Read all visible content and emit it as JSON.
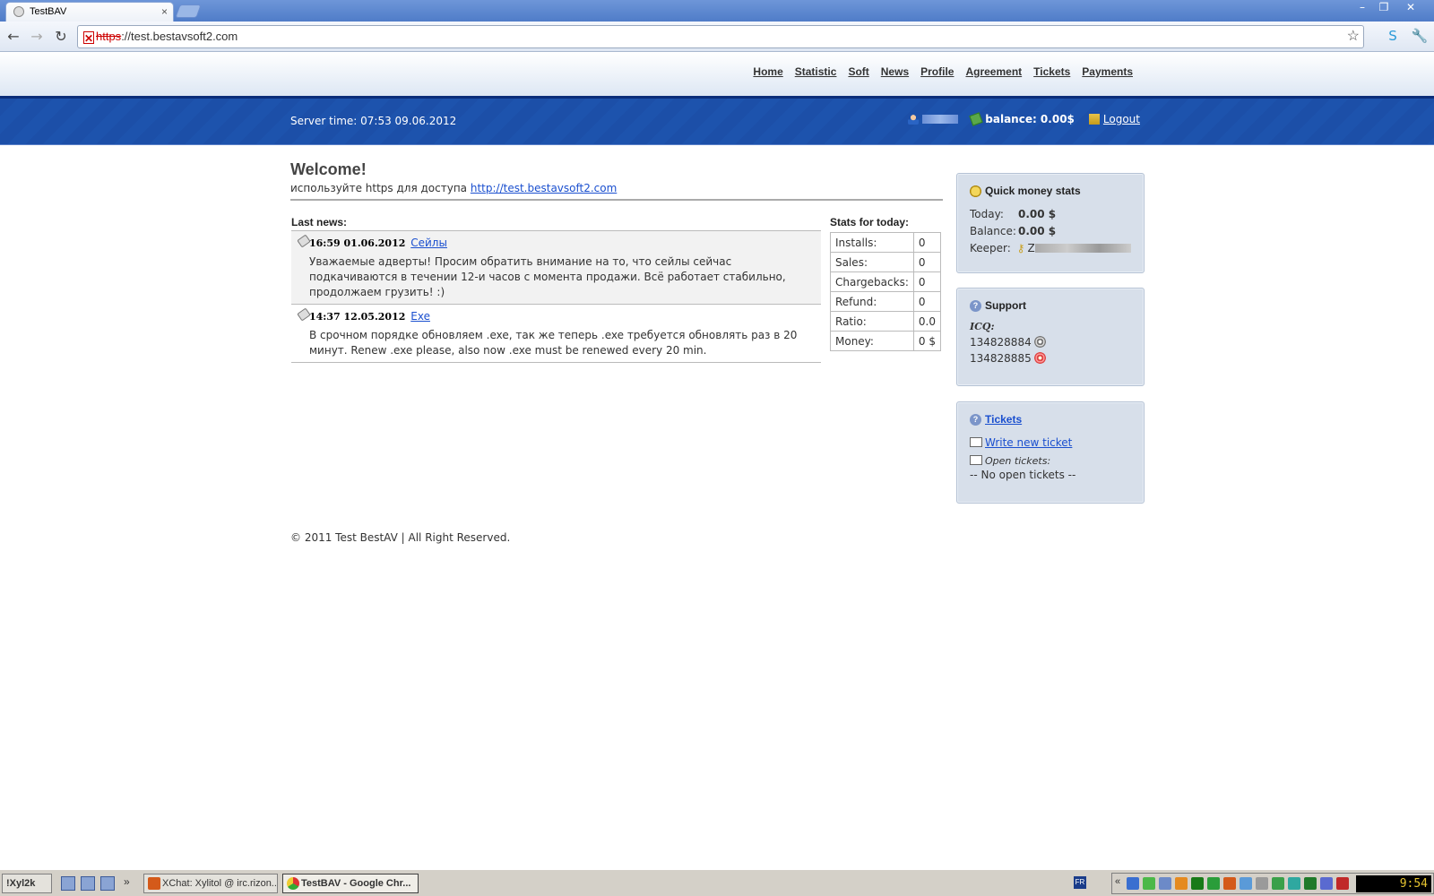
{
  "browser": {
    "tab_title": "TestBAV",
    "url_protocol": "https",
    "url_rest": "://test.bestavsoft2.com"
  },
  "nav": [
    "Home",
    "Statistic",
    "Soft",
    "News",
    "Profile",
    "Agreement",
    "Tickets",
    "Payments"
  ],
  "band": {
    "server_time": "Server time: 07:53 09.06.2012",
    "balance": "balance: 0.00$",
    "logout": "Logout"
  },
  "welcome": {
    "title": "Welcome!",
    "hint": "используйте https для доступа",
    "hint_link": "http://test.bestavsoft2.com"
  },
  "news": {
    "title": "Last news:",
    "items": [
      {
        "meta": "16:59 01.06.2012",
        "link": "Сейлы",
        "body": "Уважаемые адверты! Просим обратить внимание на то, что сейлы сейчас подкачиваются в течении 12-и часов с момента продажи. Всё работает стабильно, продолжаем грузить! :)"
      },
      {
        "meta": "14:37 12.05.2012",
        "link": "Exe",
        "body": "В срочном порядке обновляем .exe, так же теперь .exe требуется обновлять раз в 20 минут. Renew .exe please, also now .exe must be renewed every 20 min."
      }
    ]
  },
  "stats": {
    "title": "Stats for today:",
    "rows": [
      {
        "label": "Installs:",
        "value": "0"
      },
      {
        "label": "Sales:",
        "value": "0"
      },
      {
        "label": "Chargebacks:",
        "value": "0"
      },
      {
        "label": "Refund:",
        "value": "0"
      },
      {
        "label": "Ratio:",
        "value": "0.0"
      },
      {
        "label": "Money:",
        "value": "0 $"
      }
    ]
  },
  "quick_money": {
    "title": "Quick money stats",
    "today_label": "Today:",
    "today_value": "0.00 $",
    "balance_label": "Balance:",
    "balance_value": "0.00 $",
    "keeper_label": "Keeper:",
    "keeper_prefix": "Z"
  },
  "support": {
    "title": "Support",
    "icq_label": "ICQ:",
    "icq_numbers": [
      "134828884",
      "134828885"
    ]
  },
  "tickets": {
    "title": "Tickets",
    "write_new": "Write new ticket",
    "open_label": "Open tickets:",
    "none": "-- No open tickets --"
  },
  "footer": "© 2011 Test BestAV | All Right Reserved.",
  "taskbar": {
    "start": "!Xyl2k",
    "tasks": [
      "XChat: Xylitol @ irc.rizon...",
      "TestBAV - Google Chr..."
    ],
    "lang": "FR",
    "clock": "9:54"
  }
}
